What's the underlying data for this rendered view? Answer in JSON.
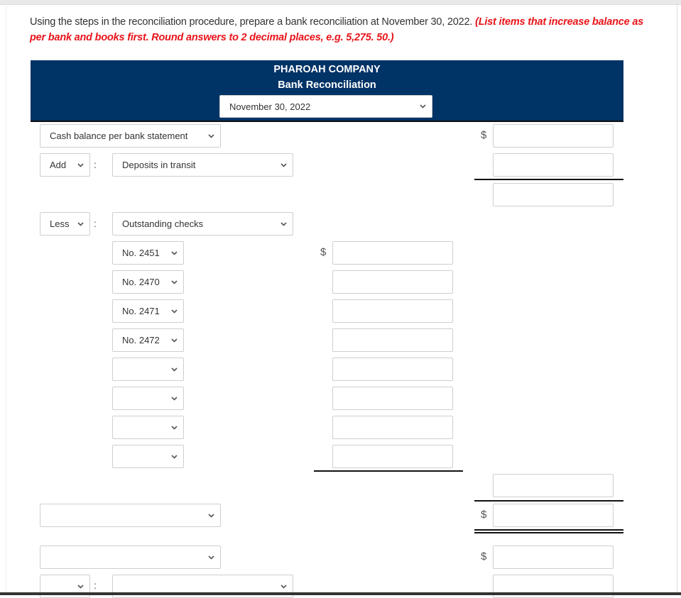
{
  "instructions": {
    "text": "Using the steps in the reconciliation procedure, prepare a bank reconciliation at November 30, 2022.",
    "note": "(List items that increase balance as per bank and books first. Round answers to 2 decimal places, e.g. 5,275. 50.)"
  },
  "header": {
    "company": "PHAROAH COMPANY",
    "title": "Bank Reconciliation",
    "date_select": "November 30, 2022"
  },
  "rows": {
    "balance_label": "Cash balance per bank statement",
    "add_op": "Add",
    "add_item": "Deposits in transit",
    "less_op": "Less",
    "less_item": "Outstanding checks",
    "checks": [
      "No. 2451",
      "No. 2470",
      "No. 2471",
      "No. 2472",
      "",
      "",
      "",
      ""
    ],
    "adjusted_label": "",
    "books_label": "",
    "books_op": "",
    "books_item": ""
  },
  "currency_symbol": "$",
  "colon": ":",
  "icons": {
    "dropdown": "chevron-down-icon"
  }
}
